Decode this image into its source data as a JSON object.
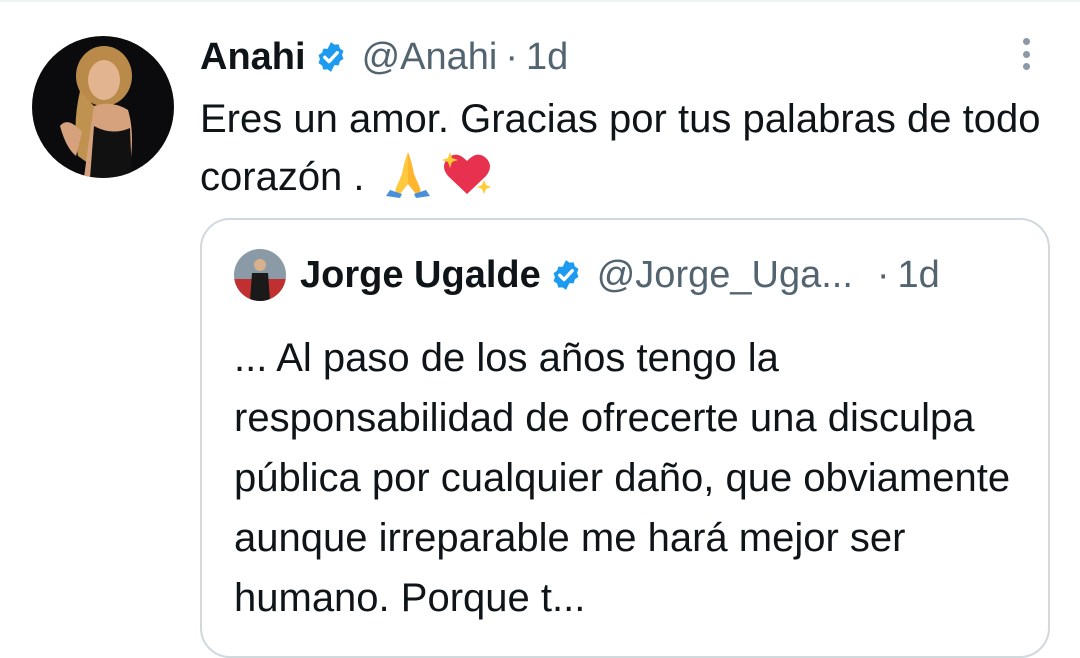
{
  "tweet": {
    "author_name": "Anahi",
    "author_handle": "@Anahi",
    "separator": "·",
    "time": "1d",
    "text": "Eres un amor. Gracias por tus palabras de todo corazón . ",
    "emojis": [
      "folded-hands",
      "sparkling-heart"
    ]
  },
  "quoted_tweet": {
    "author_name": "Jorge Ugalde",
    "author_handle": "@Jorge_Uga...",
    "separator": "·",
    "time": "1d",
    "text": "... Al paso de los años tengo la responsabilidad de ofrecerte una disculpa pública por cualquier daño, que obviamente aunque irreparable me hará mejor ser humano. Porque t..."
  },
  "colors": {
    "verified_blue": "#1d9bf0",
    "secondary_text": "#536471",
    "border": "#cfd9de"
  }
}
